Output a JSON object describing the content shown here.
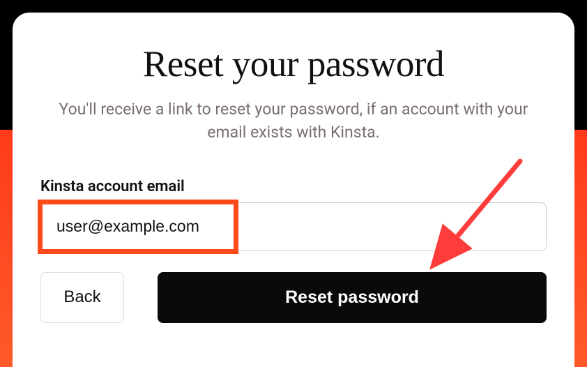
{
  "heading": {
    "title": "Reset your password",
    "subtitle": "You'll receive a link to reset your password, if an account with your email exists with Kinsta."
  },
  "form": {
    "email_label": "Kinsta account email",
    "email_value": "user@example.com"
  },
  "buttons": {
    "back_label": "Back",
    "reset_label": "Reset password"
  },
  "colors": {
    "highlight": "#ff4a1a",
    "arrow": "#ff3c3c",
    "primary_button_bg": "#0a0a0a"
  }
}
